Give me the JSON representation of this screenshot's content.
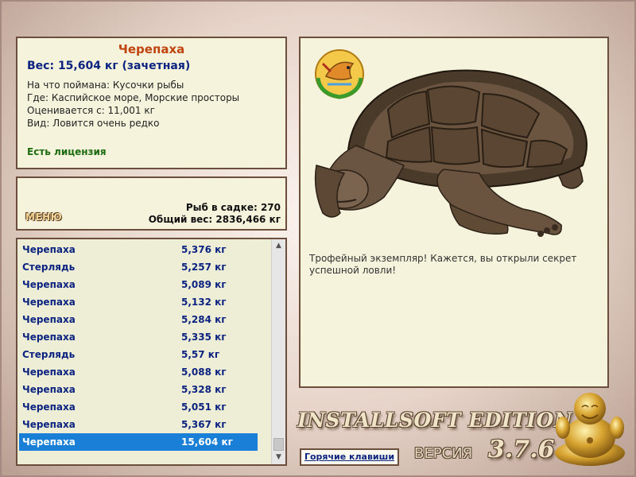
{
  "info": {
    "title": "Черепаха",
    "weight": "Вес: 15,604 кг (зачетная)",
    "bait": "На что поймана: Кусочки рыбы",
    "location": "Где: Каспийское море, Морские просторы",
    "min_weight": "Оценивается с: 11,001 кг",
    "rarity": "Вид: Ловится очень редко",
    "license": "Есть лицензия"
  },
  "status": {
    "menu_label": "МЕНЮ",
    "fish_count": "Рыб в садке: 270",
    "total_weight": "Общий вес: 2836,466 кг"
  },
  "catch_list": [
    {
      "name": "Черепаха",
      "weight": "5,376 кг"
    },
    {
      "name": "Стерлядь",
      "weight": "5,257 кг"
    },
    {
      "name": "Черепаха",
      "weight": "5,089 кг"
    },
    {
      "name": "Черепаха",
      "weight": "5,132 кг"
    },
    {
      "name": "Черепаха",
      "weight": "5,284 кг"
    },
    {
      "name": "Черепаха",
      "weight": "5,335 кг"
    },
    {
      "name": "Стерлядь",
      "weight": "5,57 кг"
    },
    {
      "name": "Черепаха",
      "weight": "5,088 кг"
    },
    {
      "name": "Черепаха",
      "weight": "5,328 кг"
    },
    {
      "name": "Черепаха",
      "weight": "5,051 кг"
    },
    {
      "name": "Черепаха",
      "weight": "5,367 кг"
    },
    {
      "name": "Черепаха",
      "weight": "15,604 кг"
    }
  ],
  "selected_index": 11,
  "detail": {
    "description": "Трофейный экземпляр! Кажется, вы открыли секрет успешной ловли!"
  },
  "footer": {
    "brand": "INSTALLSOFT EDITION",
    "version_label": "ВЕРСИЯ",
    "version": "3.7.6",
    "hotkeys": "Горячие клавиши"
  },
  "icons": {
    "emblem": "fish-trophy-emblem-icon",
    "buddha": "golden-buddha-icon",
    "scroll_up": "chevron-up-icon",
    "scroll_down": "chevron-down-icon"
  },
  "colors": {
    "panel_bg": "#f6f3dd",
    "panel_border": "#6b4e3c",
    "title": "#c0440f",
    "text_blue": "#0c2480",
    "license_green": "#1d6b10",
    "selection": "#1a7fd6"
  }
}
